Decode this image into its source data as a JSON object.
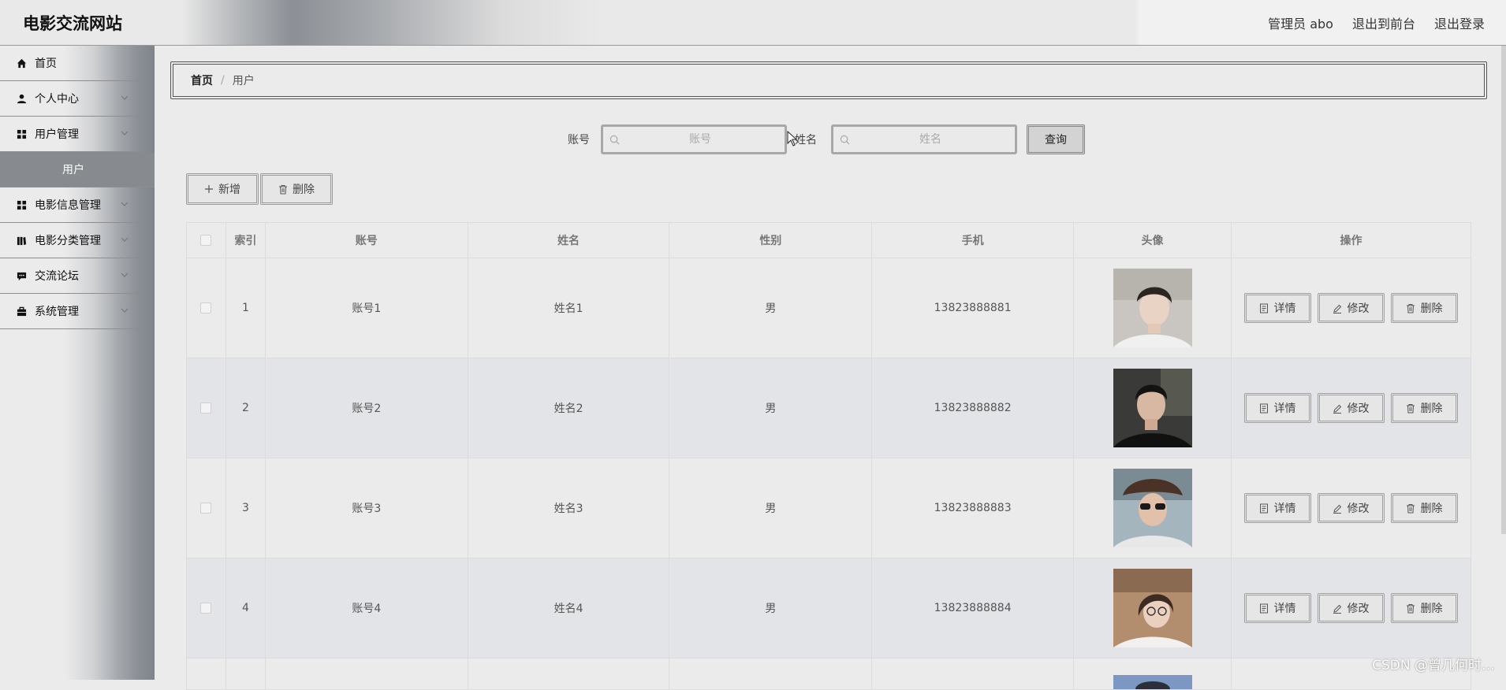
{
  "header": {
    "title": "电影交流网站",
    "user_label": "管理员 abo",
    "frontend_link": "退出到前台",
    "logout_link": "退出登录"
  },
  "sidebar": {
    "items": [
      {
        "label": "首页",
        "icon": "home-icon"
      },
      {
        "label": "个人中心",
        "icon": "person-icon"
      },
      {
        "label": "用户管理",
        "icon": "grid-icon"
      },
      {
        "label": "用户",
        "icon": "",
        "sub": true
      },
      {
        "label": "电影信息管理",
        "icon": "grid-icon"
      },
      {
        "label": "电影分类管理",
        "icon": "book-icon"
      },
      {
        "label": "交流论坛",
        "icon": "chat-icon"
      },
      {
        "label": "系统管理",
        "icon": "briefcase-icon"
      }
    ]
  },
  "breadcrumb": {
    "home": "首页",
    "separator": "/",
    "current": "用户"
  },
  "search": {
    "account_label": "账号",
    "account_placeholder": "账号",
    "name_label": "姓名",
    "name_placeholder": "姓名",
    "query_button": "查询"
  },
  "toolbar": {
    "add_label": "新增",
    "delete_label": "删除"
  },
  "table": {
    "headers": [
      "索引",
      "账号",
      "姓名",
      "性别",
      "手机",
      "头像",
      "操作"
    ],
    "rows": [
      {
        "index": "1",
        "account": "账号1",
        "name": "姓名1",
        "gender": "男",
        "phone": "13823888881"
      },
      {
        "index": "2",
        "account": "账号2",
        "name": "姓名2",
        "gender": "男",
        "phone": "13823888882"
      },
      {
        "index": "3",
        "account": "账号3",
        "name": "姓名3",
        "gender": "男",
        "phone": "13823888883"
      },
      {
        "index": "4",
        "account": "账号4",
        "name": "姓名4",
        "gender": "男",
        "phone": "13823888884"
      }
    ],
    "actions": {
      "detail": "详情",
      "edit": "修改",
      "delete": "删除"
    }
  },
  "watermark": "CSDN @曾几何时…"
}
